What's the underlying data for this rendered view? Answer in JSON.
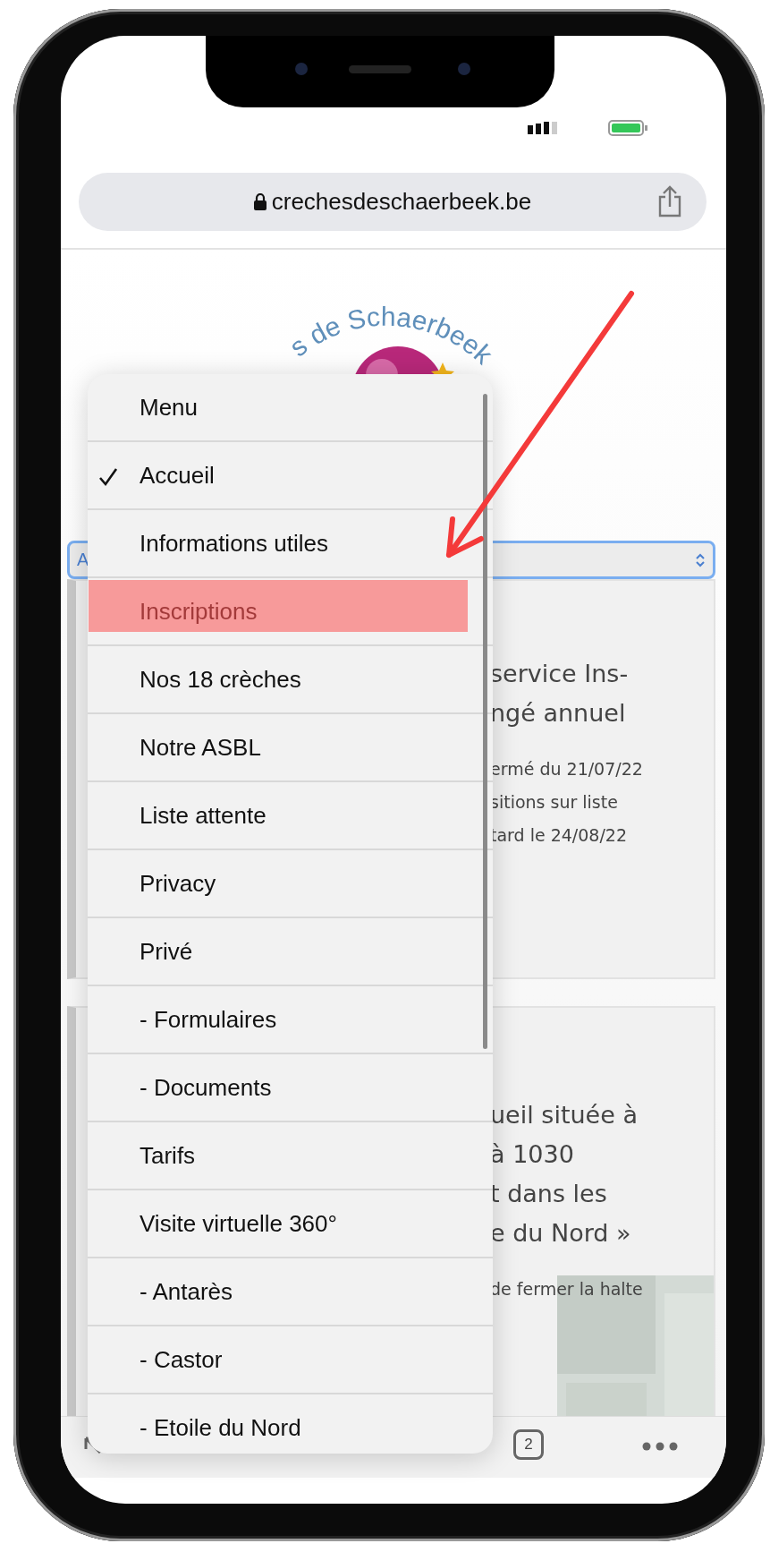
{
  "address_bar": {
    "url": "crechesdeschaerbeek.be"
  },
  "logo": {
    "text": "s de Schaerbeek"
  },
  "select_field": {
    "value": "A"
  },
  "cards": [
    {
      "title_lines": [
        "service Ins-",
        "ngé annuel"
      ],
      "body_lines": [
        "ermé du 21/07/22",
        "sitions sur liste",
        "tard le 24/08/22"
      ]
    },
    {
      "title_lines": [
        "ueil située à",
        "à 1030",
        "t dans les",
        "e du Nord »"
      ],
      "body_lines": [
        "de fermer la halte"
      ],
      "picture": {
        "kind": "picture"
      }
    }
  ],
  "dropdown": {
    "items": [
      {
        "label": "Menu",
        "checked": false,
        "highlighted": false
      },
      {
        "label": "Accueil",
        "checked": true,
        "highlighted": false
      },
      {
        "label": "Informations utiles",
        "checked": false,
        "highlighted": false
      },
      {
        "label": "Inscriptions",
        "checked": false,
        "highlighted": true
      },
      {
        "label": "Nos 18 crèches",
        "checked": false,
        "highlighted": false
      },
      {
        "label": "Notre ASBL",
        "checked": false,
        "highlighted": false
      },
      {
        "label": "Liste attente",
        "checked": false,
        "highlighted": false
      },
      {
        "label": "Privacy",
        "checked": false,
        "highlighted": false
      },
      {
        "label": "Privé",
        "checked": false,
        "highlighted": false
      },
      {
        "label": "- Formulaires",
        "checked": false,
        "highlighted": false
      },
      {
        "label": "- Documents",
        "checked": false,
        "highlighted": false
      },
      {
        "label": "Tarifs",
        "checked": false,
        "highlighted": false
      },
      {
        "label": "Visite virtuelle 360°",
        "checked": false,
        "highlighted": false
      },
      {
        "label": "- Antarès",
        "checked": false,
        "highlighted": false
      },
      {
        "label": "- Castor",
        "checked": false,
        "highlighted": false
      },
      {
        "label": "- Etoile du Nord",
        "checked": false,
        "highlighted": false
      }
    ]
  },
  "toolbar": {
    "tab_count": "2"
  }
}
